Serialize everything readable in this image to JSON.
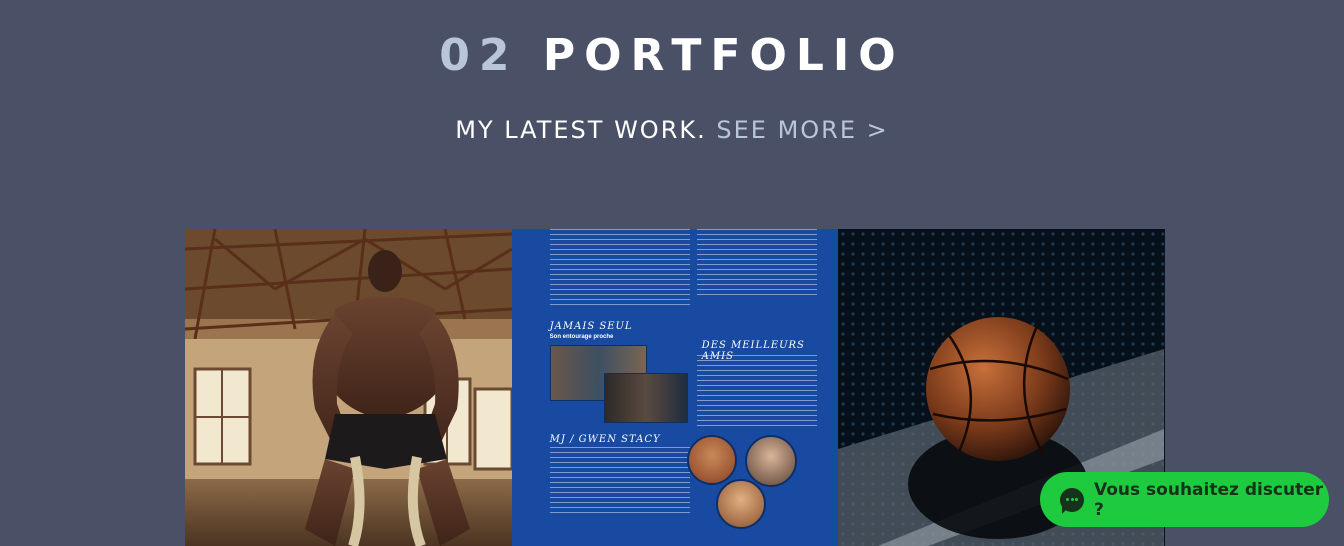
{
  "header": {
    "number": "02",
    "title": "PORTFOLIO",
    "subtitle": "MY LATEST WORK.",
    "see_more": "SEE MORE >"
  },
  "gallery": {
    "magazine": {
      "heading_1": "JAMAIS SEUL",
      "subheading_1": "Son entourage proche",
      "heading_2": "DES MEILLEURS AMIS",
      "heading_3": "MJ / GWEN STACY"
    }
  },
  "chat": {
    "label": "Vous souhaitez discuter ?"
  },
  "colors": {
    "background": "#4a5066",
    "accent": "#b9c5d9",
    "chat_green": "#1ecb3f",
    "magazine_blue": "#174aa0"
  },
  "icons": {
    "chat": "chat-bubble-icon"
  }
}
